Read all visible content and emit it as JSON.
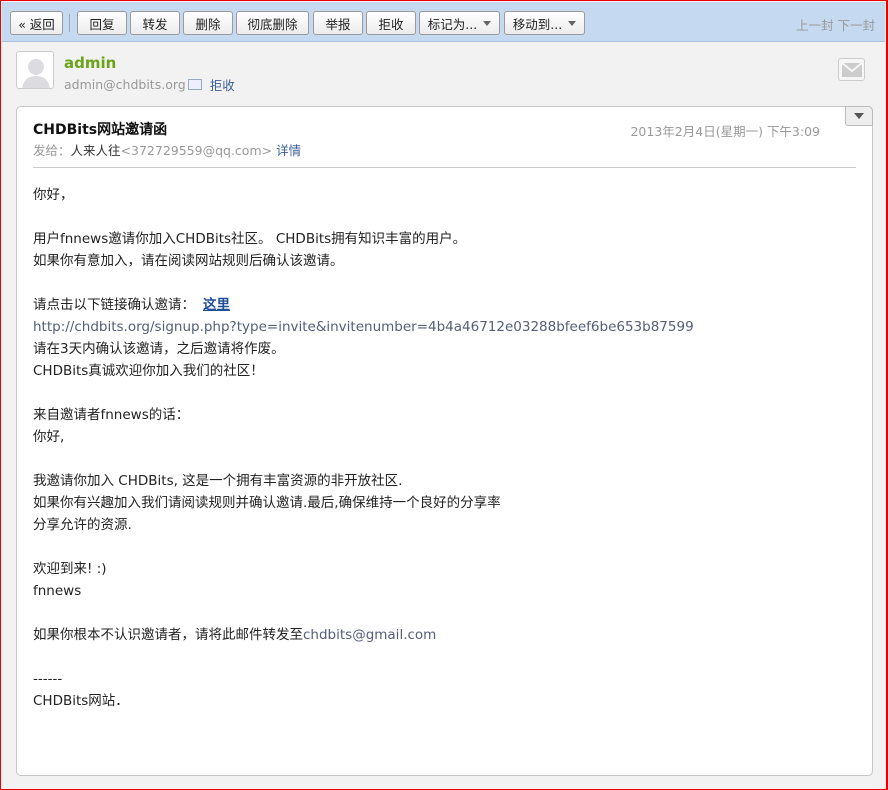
{
  "toolbar": {
    "back": "« 返回",
    "reply": "回复",
    "forward": "转发",
    "delete": "删除",
    "purge": "彻底删除",
    "report": "举报",
    "reject": "拒收",
    "mark_as": "标记为...",
    "move_to": "移动到...",
    "prev": "上一封",
    "next": "下一封"
  },
  "sender": {
    "name": "admin",
    "email": "admin@chdbits.org",
    "reject": "拒收"
  },
  "message": {
    "subject": "CHDBits网站邀请函",
    "date": "2013年2月4日(星期一) 下午3:09",
    "to_label": "发给：",
    "to_name": "人来人往",
    "to_email": "<372729559@qq.com>",
    "details": "详情",
    "lines": [
      "你好，",
      "",
      "用户fnnews邀请你加入CHDBits社区。 CHDBits拥有知识丰富的用户。",
      "如果你有意加入，请在阅读网站规则后确认该邀请。",
      "",
      "请点击以下链接确认邀请：",
      "http://chdbits.org/signup.php?type=invite&invitenumber=4b4a46712e03288bfeef6be653b87599",
      "请在3天内确认该邀请，之后邀请将作废。",
      "CHDBits真诚欢迎你加入我们的社区！",
      "",
      "来自邀请者fnnews的话：",
      "你好,",
      "",
      "我邀请你加入 CHDBits, 这是一个拥有丰富资源的非开放社区.",
      "如果你有兴趣加入我们请阅读规则并确认邀请.最后,确保维持一个良好的分享率",
      "分享允许的资源.",
      "",
      "欢迎到来! :)",
      "fnnews",
      "",
      "如果你根本不认识邀请者，请将此邮件转发至",
      "",
      "------",
      "CHDBits网站．"
    ],
    "here_link": "这里",
    "forward_email": "chdbits@gmail.com"
  }
}
